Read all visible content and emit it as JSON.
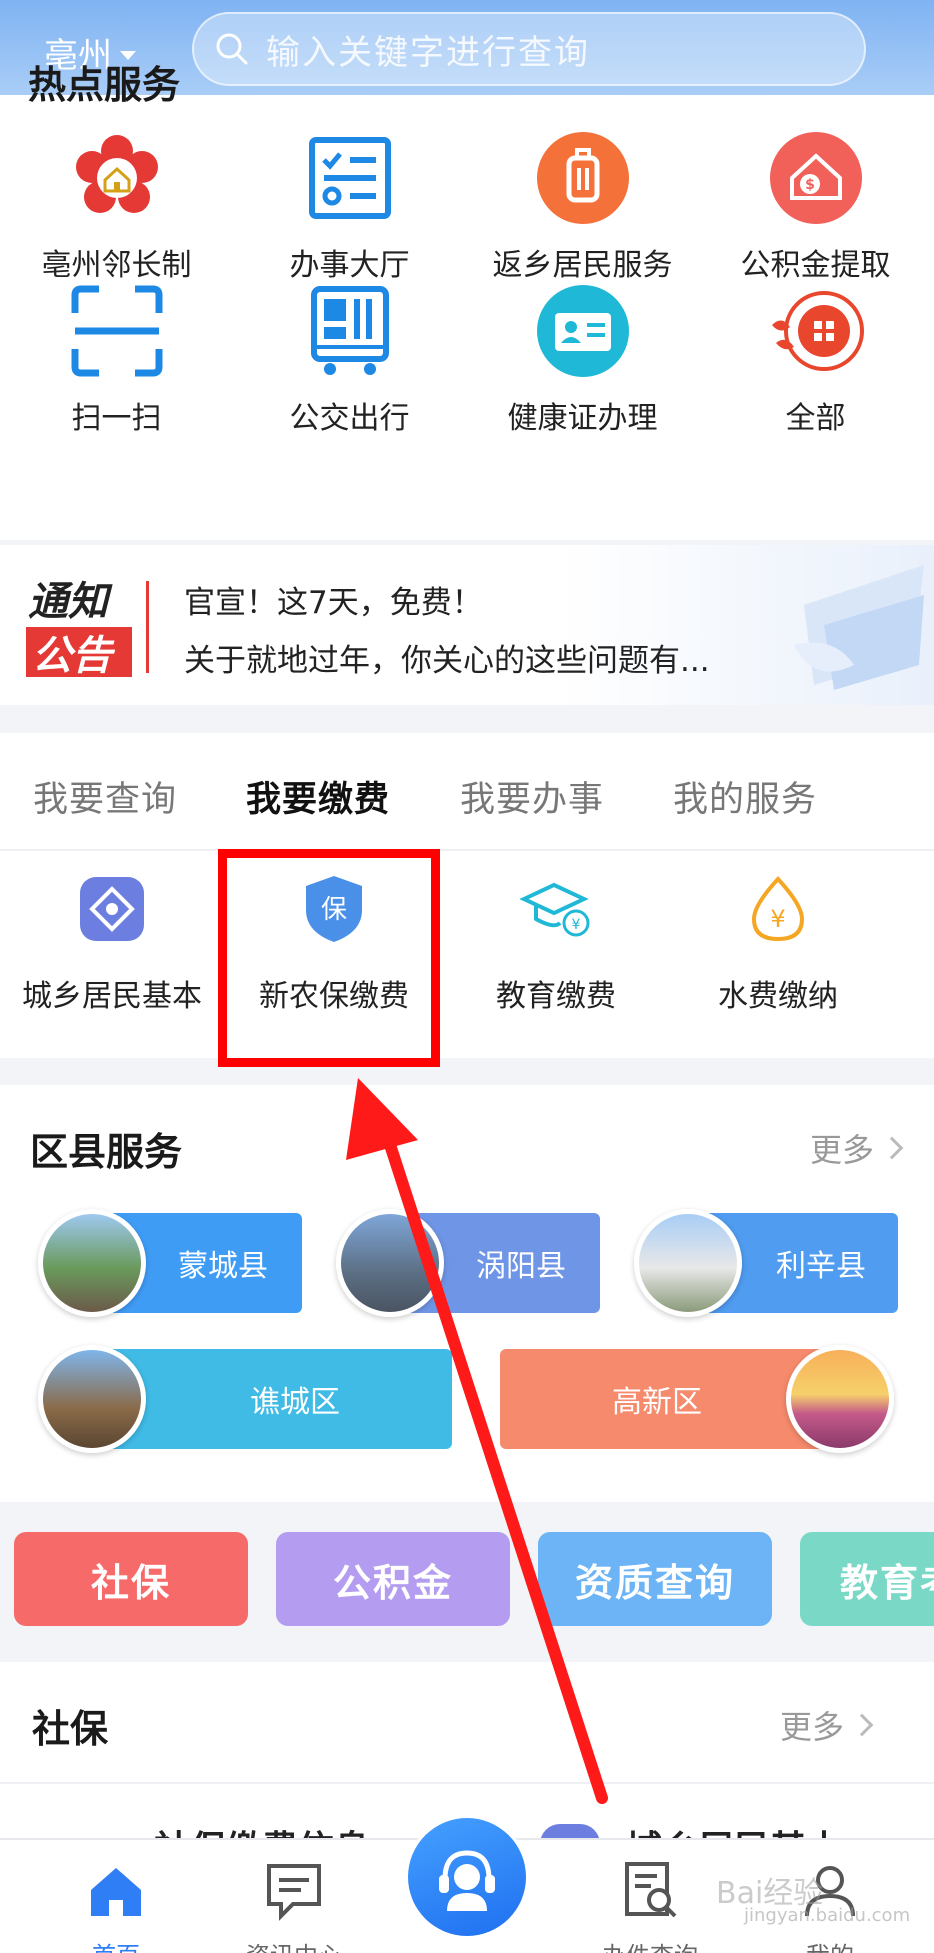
{
  "header": {
    "city": "亳州",
    "search_placeholder": "输入关键字进行查询"
  },
  "hot_services": {
    "title": "热点服务",
    "items": [
      {
        "label": "亳州邻长制",
        "icon": "flower-house-icon"
      },
      {
        "label": "办事大厅",
        "icon": "checklist-icon"
      },
      {
        "label": "返乡居民服务",
        "icon": "luggage-icon"
      },
      {
        "label": "公积金提取",
        "icon": "house-coin-icon"
      },
      {
        "label": "扫一扫",
        "icon": "scan-icon"
      },
      {
        "label": "公交出行",
        "icon": "bus-card-icon"
      },
      {
        "label": "健康证办理",
        "icon": "id-card-icon"
      },
      {
        "label": "全部",
        "icon": "all-apps-icon"
      }
    ]
  },
  "notice": {
    "badge_line1": "通知",
    "badge_line2": "公告",
    "line1": "官宣！这7天，免费！",
    "line2": "关于就地过年，你关心的这些问题有..."
  },
  "pay_tabs": {
    "tabs": [
      {
        "label": "我要查询",
        "active": false
      },
      {
        "label": "我要缴费",
        "active": true
      },
      {
        "label": "我要办事",
        "active": false
      },
      {
        "label": "我的服务",
        "active": false
      }
    ],
    "items": [
      {
        "label": "城乡居民基本",
        "icon": "diamond-icon",
        "color": "#6c7fe0"
      },
      {
        "label": "新农保缴费",
        "icon": "shield-icon",
        "color": "#4a90e8",
        "badge": "保"
      },
      {
        "label": "教育缴费",
        "icon": "graduation-cap-icon",
        "color": "#1fb8d6"
      },
      {
        "label": "水费缴纳",
        "icon": "water-drop-icon",
        "color": "#f5a623"
      }
    ]
  },
  "district": {
    "title": "区县服务",
    "more": "更多",
    "items": [
      {
        "label": "蒙城县",
        "color": "#3f9cf5"
      },
      {
        "label": "涡阳县",
        "color": "#6f95e6"
      },
      {
        "label": "利辛县",
        "color": "#4f9cf0"
      },
      {
        "label": "谯城区",
        "color": "#3fbbe6"
      },
      {
        "label": "高新区",
        "color": "#f68a6c"
      }
    ]
  },
  "categories": [
    {
      "label": "社保",
      "color": "#f76a6a"
    },
    {
      "label": "公积金",
      "color": "#b49cf0"
    },
    {
      "label": "资质查询",
      "color": "#6cb4f5"
    },
    {
      "label": "教育考",
      "color": "#7ad9c6"
    }
  ],
  "shebao": {
    "title": "社保",
    "more": "更多",
    "item1": "社保缴费信息",
    "item2": "城乡居民基本"
  },
  "bottom_nav": [
    {
      "label": "首页",
      "active": true
    },
    {
      "label": "资讯中心",
      "active": false
    },
    {
      "label": "办件查询",
      "active": false
    },
    {
      "label": "我的",
      "active": false
    }
  ],
  "watermark": {
    "brand": "Bai经验",
    "url": "jingyan.baidu.com"
  }
}
